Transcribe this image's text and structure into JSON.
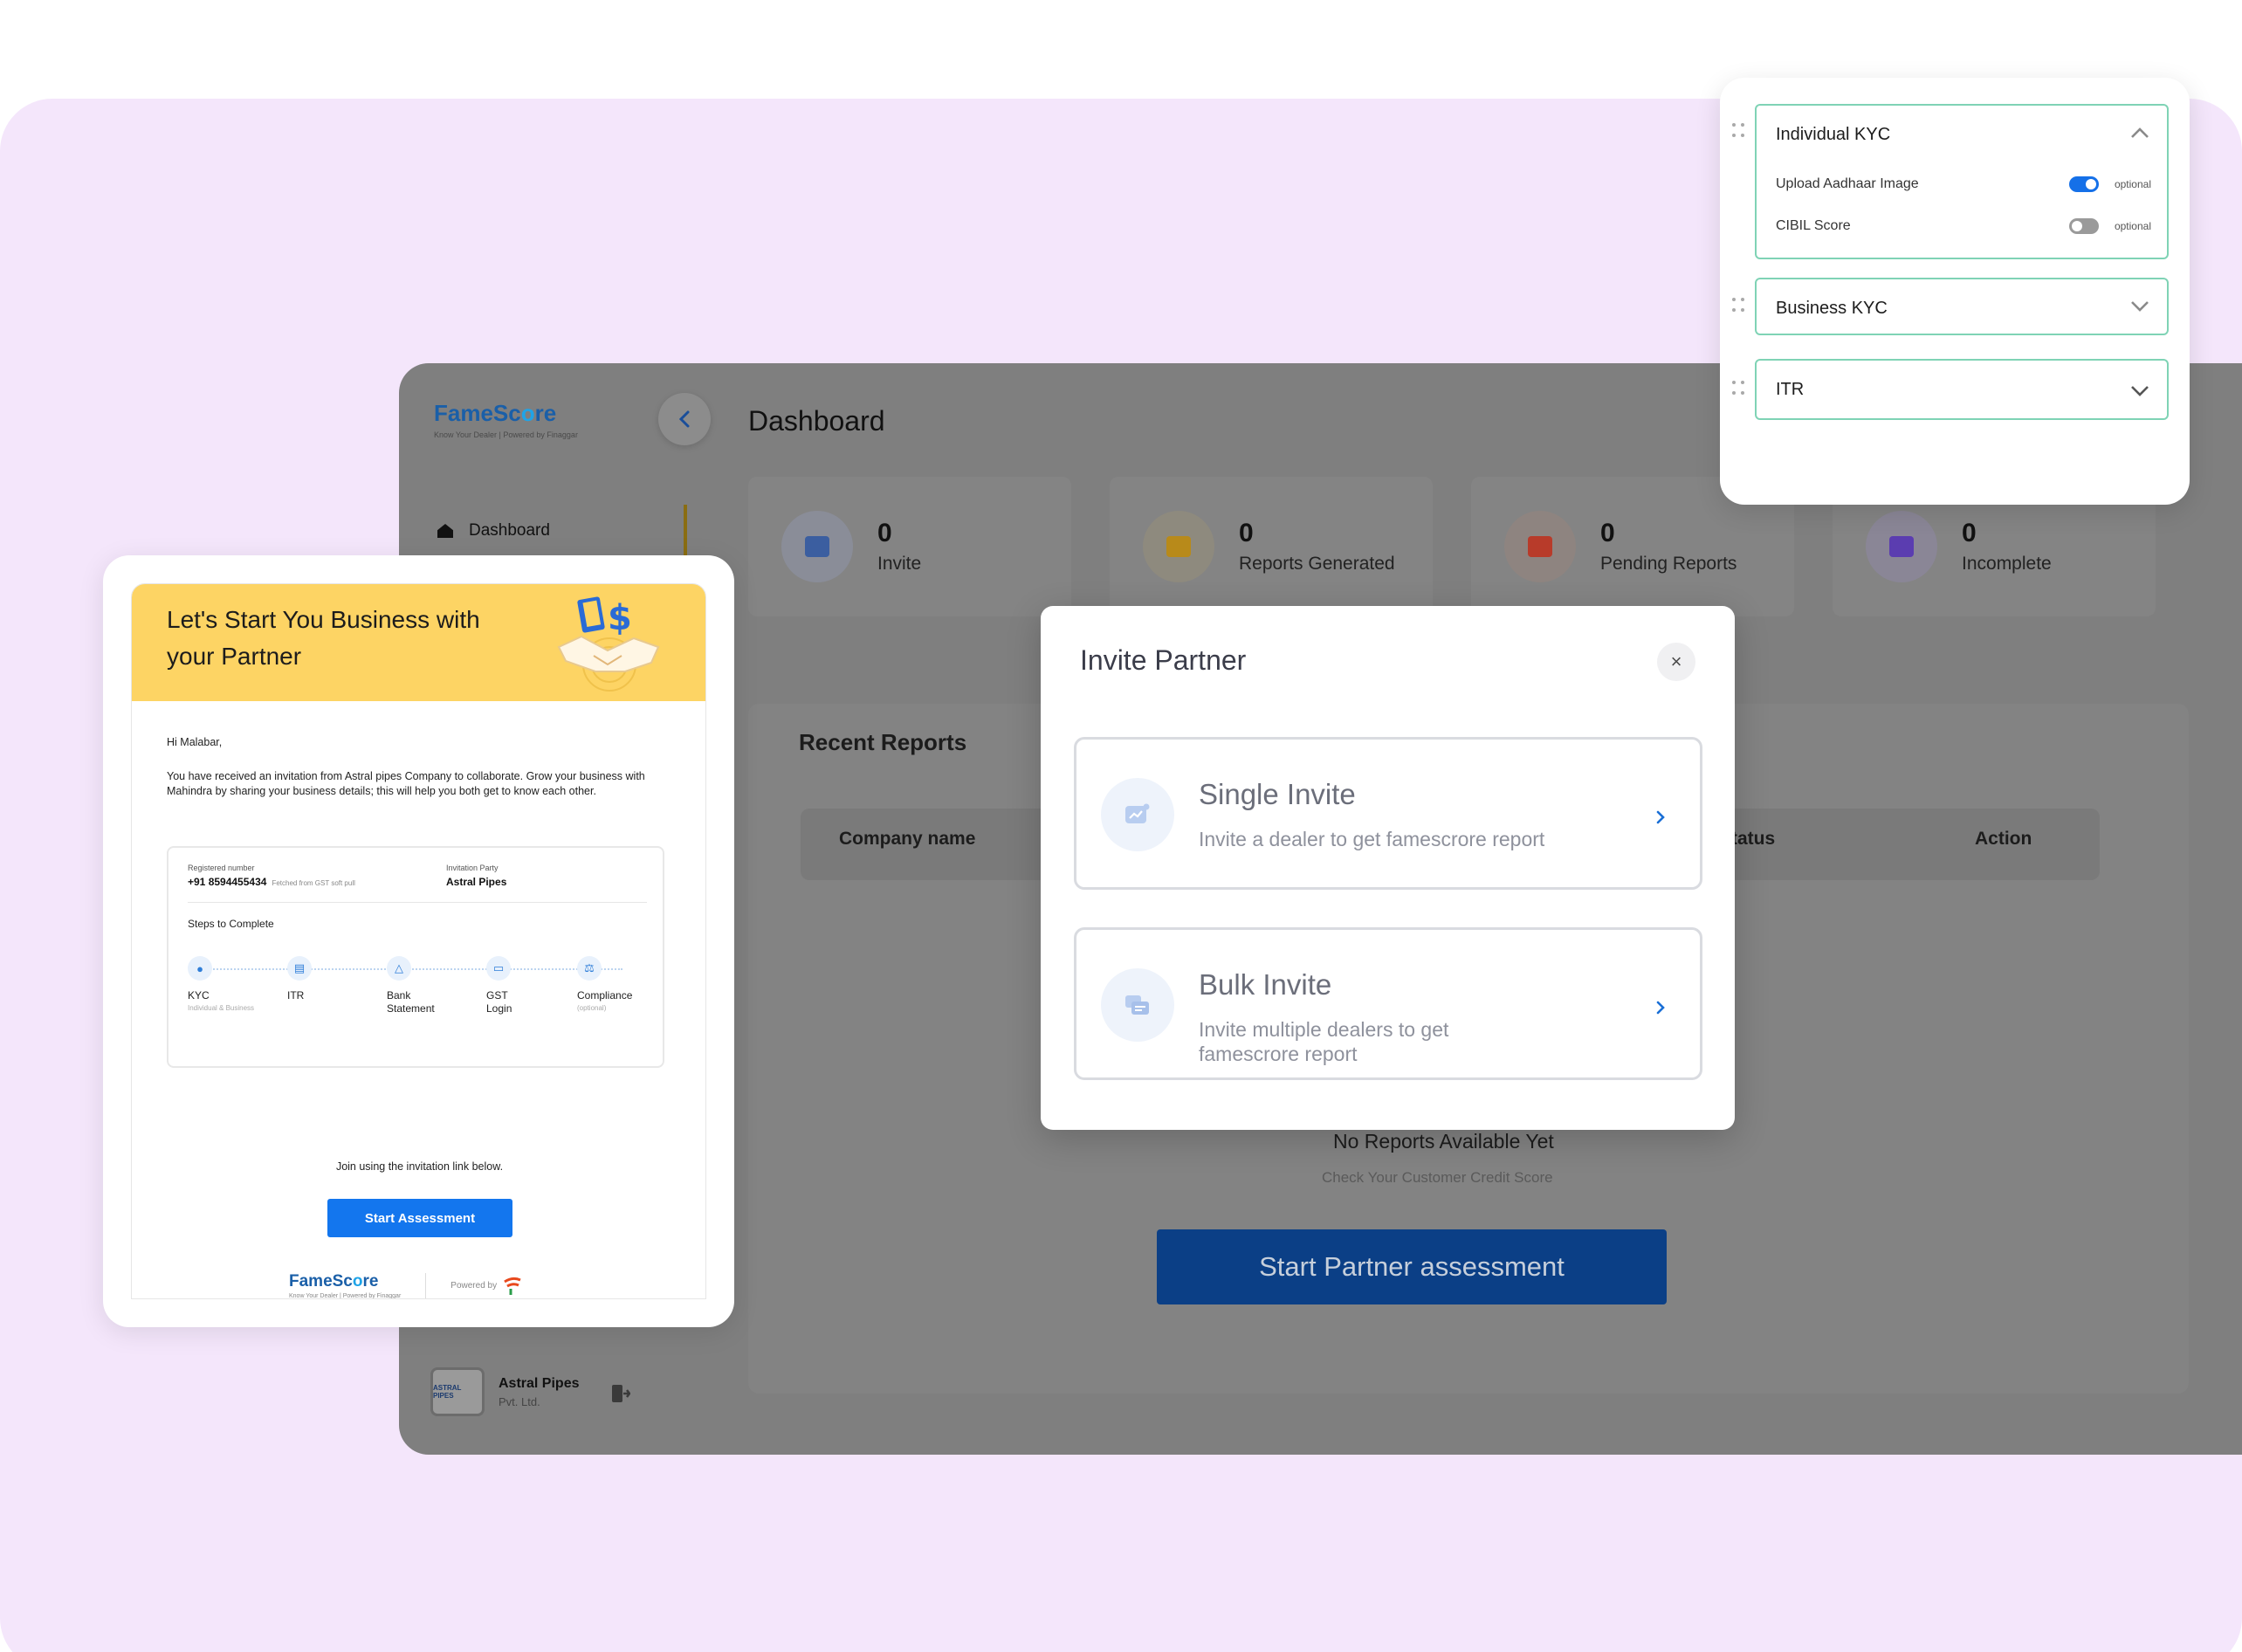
{
  "dashboard": {
    "logo": {
      "brand_prefix": "FameSc",
      "brand_o": "o",
      "brand_suffix": "re",
      "tagline": "Know Your Dealer | Powered by Finaggar"
    },
    "page_title": "Dashboard",
    "nav_item": "Dashboard",
    "stats": [
      {
        "value": "0",
        "label": "Invite",
        "color": "#3b5ea0",
        "bg": "#8a8d98"
      },
      {
        "value": "0",
        "label": "Reports Generated",
        "color": "#b88a1a",
        "bg": "#8e8a7e"
      },
      {
        "value": "0",
        "label": "Pending Reports",
        "color": "#b83b2a",
        "bg": "#8e8480"
      },
      {
        "value": "0",
        "label": "Incomplete",
        "color": "#5b3db0",
        "bg": "#8a8696"
      }
    ],
    "recent_reports_title": "Recent Reports",
    "table_headers": {
      "company": "Company name",
      "status": "tatus",
      "action": "Action"
    },
    "empty_title": "No Reports Available Yet",
    "empty_sub": "Check Your Customer Credit Score",
    "start_button": "Start Partner assessment",
    "company": {
      "logo_text": "ASTRAL PIPES",
      "name": "Astral Pipes",
      "sub": "Pvt. Ltd."
    }
  },
  "modal": {
    "title": "Invite Partner",
    "close": "×",
    "options": [
      {
        "title": "Single Invite",
        "subtitle": "Invite a dealer to get famescrore report"
      },
      {
        "title": "Bulk Invite",
        "subtitle": "Invite multiple dealers to get famescrore report"
      }
    ]
  },
  "email": {
    "banner_title": "Let's Start You Business with your Partner",
    "greeting": "Hi Malabar,",
    "message": "You have received an invitation from Astral pipes Company to collaborate. Grow your business with Mahindra by sharing your business details; this will help you both get to know each other.",
    "registered_label": "Registered number",
    "registered_value": "+91 8594455434",
    "fetched_note": "Fetched from GST soft pull",
    "party_label": "Invitation Party",
    "party_value": "Astral Pipes",
    "steps_title": "Steps to Complete",
    "steps": [
      {
        "label": "KYC",
        "sub": "Individual & Business"
      },
      {
        "label": "ITR",
        "sub": ""
      },
      {
        "label": "Bank Statement",
        "sub": ""
      },
      {
        "label": "GST Login",
        "sub": ""
      },
      {
        "label": "Compliance",
        "sub": "(optional)"
      }
    ],
    "join_text": "Join using the invitation link below.",
    "button": "Start Assessment",
    "footer_tagline": "Know Your Dealer | Powered by Finaggar",
    "powered_by": "Powered by"
  },
  "kyc": {
    "sections": [
      {
        "title": "Individual KYC",
        "expanded": true,
        "rows": [
          {
            "label": "Upload Aadhaar Image",
            "toggle": "on",
            "tag": "optional"
          },
          {
            "label": "CIBIL Score",
            "toggle": "off",
            "tag": "optional"
          }
        ]
      },
      {
        "title": "Business KYC",
        "expanded": false
      },
      {
        "title": "ITR",
        "expanded": false
      }
    ]
  },
  "colors": {
    "background_panel": "#f4e6fb",
    "primary_blue": "#1376ee",
    "banner_yellow": "#fdd464",
    "kyc_border": "#7fd3b5"
  }
}
